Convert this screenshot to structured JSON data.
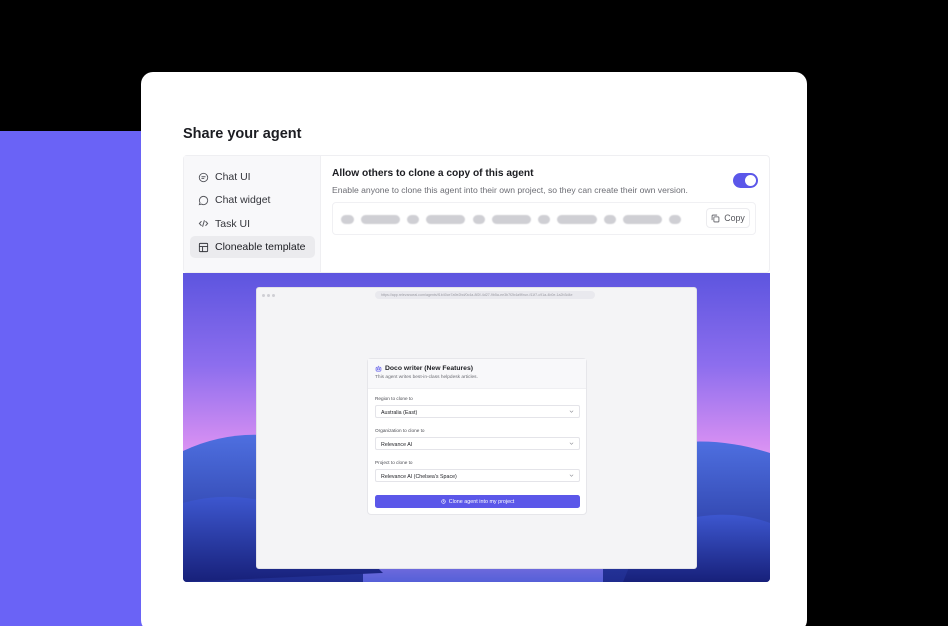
{
  "page_title": "Share your agent",
  "sidebar": {
    "items": [
      {
        "label": "Chat UI",
        "icon": "chat-bubble-icon",
        "active": false
      },
      {
        "label": "Chat widget",
        "icon": "message-circle-icon",
        "active": false
      },
      {
        "label": "Task UI",
        "icon": "code-icon",
        "active": false
      },
      {
        "label": "Cloneable template",
        "icon": "template-layout-icon",
        "active": true
      }
    ]
  },
  "clone_settings": {
    "title": "Allow others to clone a copy of this agent",
    "description": "Enable anyone to clone this agent into their own project, so they can create their own version.",
    "toggle_on": true,
    "copy_label": "Copy"
  },
  "preview": {
    "browser_url": "https://app.relevanceai.com/agents/f1b40ce7a9e2bd/0c4a-8f2f-4d27-9b5a-ee3b7f2b4a9f/run-f11f7-c91a-4b0e-1a2b3d4e",
    "form": {
      "title": "Doco writer (New Features)",
      "subtitle": "This agent writes best-in-class helpdesk articles.",
      "fields": [
        {
          "label": "Region to clone to",
          "value": "Australia (East)"
        },
        {
          "label": "Organization to clone to",
          "value": "Relevance AI"
        },
        {
          "label": "Project to clone to",
          "value": "Relevance AI (Chelsea's Space)"
        }
      ],
      "button_label": "Clone agent into my project"
    }
  },
  "colors": {
    "accent": "#5b57e9",
    "left_block": "#6a63f6",
    "background": "#000000"
  }
}
